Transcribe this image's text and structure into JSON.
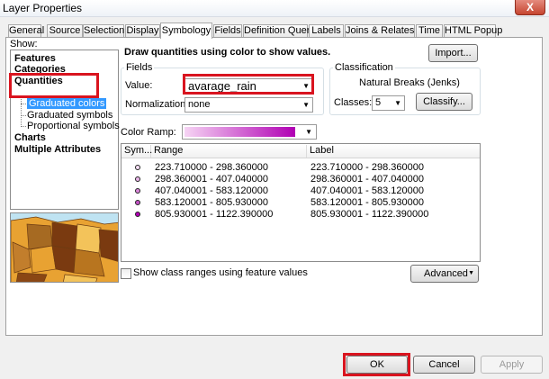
{
  "window": {
    "title": "Layer Properties",
    "close_glyph": "X"
  },
  "tabs": [
    {
      "label": "General"
    },
    {
      "label": "Source"
    },
    {
      "label": "Selection"
    },
    {
      "label": "Display"
    },
    {
      "label": "Symbology"
    },
    {
      "label": "Fields"
    },
    {
      "label": "Definition Query"
    },
    {
      "label": "Labels"
    },
    {
      "label": "Joins & Relates"
    },
    {
      "label": "Time"
    },
    {
      "label": "HTML Popup"
    }
  ],
  "active_tab": "Symbology",
  "show_panel": {
    "label": "Show:",
    "items": [
      {
        "label": "Features",
        "level": 0
      },
      {
        "label": "Categories",
        "level": 0
      },
      {
        "label": "Quantities",
        "level": 0
      },
      {
        "label": "Graduated colors",
        "level": 1,
        "selected": true
      },
      {
        "label": "Graduated symbols",
        "level": 1
      },
      {
        "label": "Proportional symbols",
        "level": 1
      },
      {
        "label": "Charts",
        "level": 0
      },
      {
        "label": "Multiple Attributes",
        "level": 0
      }
    ]
  },
  "description": "Draw quantities using color to show values.",
  "import_button": "Import...",
  "fields": {
    "group_label": "Fields",
    "value_label": "Value:",
    "value": "avarage_rain",
    "normalization_label": "Normalization:",
    "normalization": "none"
  },
  "classification": {
    "group_label": "Classification",
    "method": "Natural Breaks (Jenks)",
    "classes_label": "Classes:",
    "classes": "5",
    "classify_button": "Classify..."
  },
  "color_ramp": {
    "label": "Color Ramp:",
    "start": "#f6d4f4",
    "end": "#b000b3"
  },
  "class_table": {
    "columns": [
      "Sym...",
      "Range",
      "Label"
    ],
    "rows": [
      {
        "range": "223.710000 - 298.360000",
        "label": "223.710000 - 298.360000",
        "color": "#f7dff6"
      },
      {
        "range": "298.360001 - 407.040000",
        "label": "298.360001 - 407.040000",
        "color": "#e9b5e8"
      },
      {
        "range": "407.040001 - 583.120000",
        "label": "407.040001 - 583.120000",
        "color": "#d886d8"
      },
      {
        "range": "583.120001 - 805.930000",
        "label": "583.120001 - 805.930000",
        "color": "#c452c6"
      },
      {
        "range": "805.930001 - 1122.390000",
        "label": "805.930001 - 1122.390000",
        "color": "#b000b3"
      }
    ]
  },
  "show_class_ranges_label": "Show class ranges using feature values",
  "advanced_button": "Advanced",
  "footer": {
    "ok": "OK",
    "cancel": "Cancel",
    "apply": "Apply"
  },
  "colors": {
    "highlight": "#d9141f",
    "selection": "#3399ff",
    "map_land": "#e8a232",
    "map_dark": "#7a3a10",
    "map_water": "#bfe3f2"
  }
}
